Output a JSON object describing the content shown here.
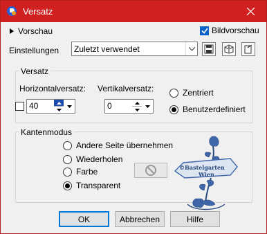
{
  "window": {
    "title": "Versatz"
  },
  "top": {
    "preview_label": "Vorschau",
    "bildvorschau_label": "Bildvorschau",
    "bildvorschau_checked": true
  },
  "settings": {
    "label": "Einstellungen",
    "value": "Zuletzt verwendet"
  },
  "versatz": {
    "title": "Versatz",
    "horizontal_label": "Horizontalversatz:",
    "horizontal_value": "40",
    "vertical_label": "Vertikalversatz:",
    "vertical_value": "0",
    "radio_centered": "Zentriert",
    "radio_custom": "Benutzerdefiniert",
    "selected": "Benutzerdefiniert"
  },
  "kanten": {
    "title": "Kantenmodus",
    "options": [
      "Andere Seite übernehmen",
      "Wiederholen",
      "Farbe",
      "Transparent"
    ],
    "selected": "Transparent"
  },
  "watermark": {
    "line1": "©Bastelgarten",
    "line2": "Wien"
  },
  "buttons": {
    "ok": "OK",
    "cancel": "Abbrechen",
    "help": "Hilfe"
  },
  "colors": {
    "titlebar": "#d12020",
    "accent": "#0a63c9",
    "watermark": "#3e66a8"
  }
}
